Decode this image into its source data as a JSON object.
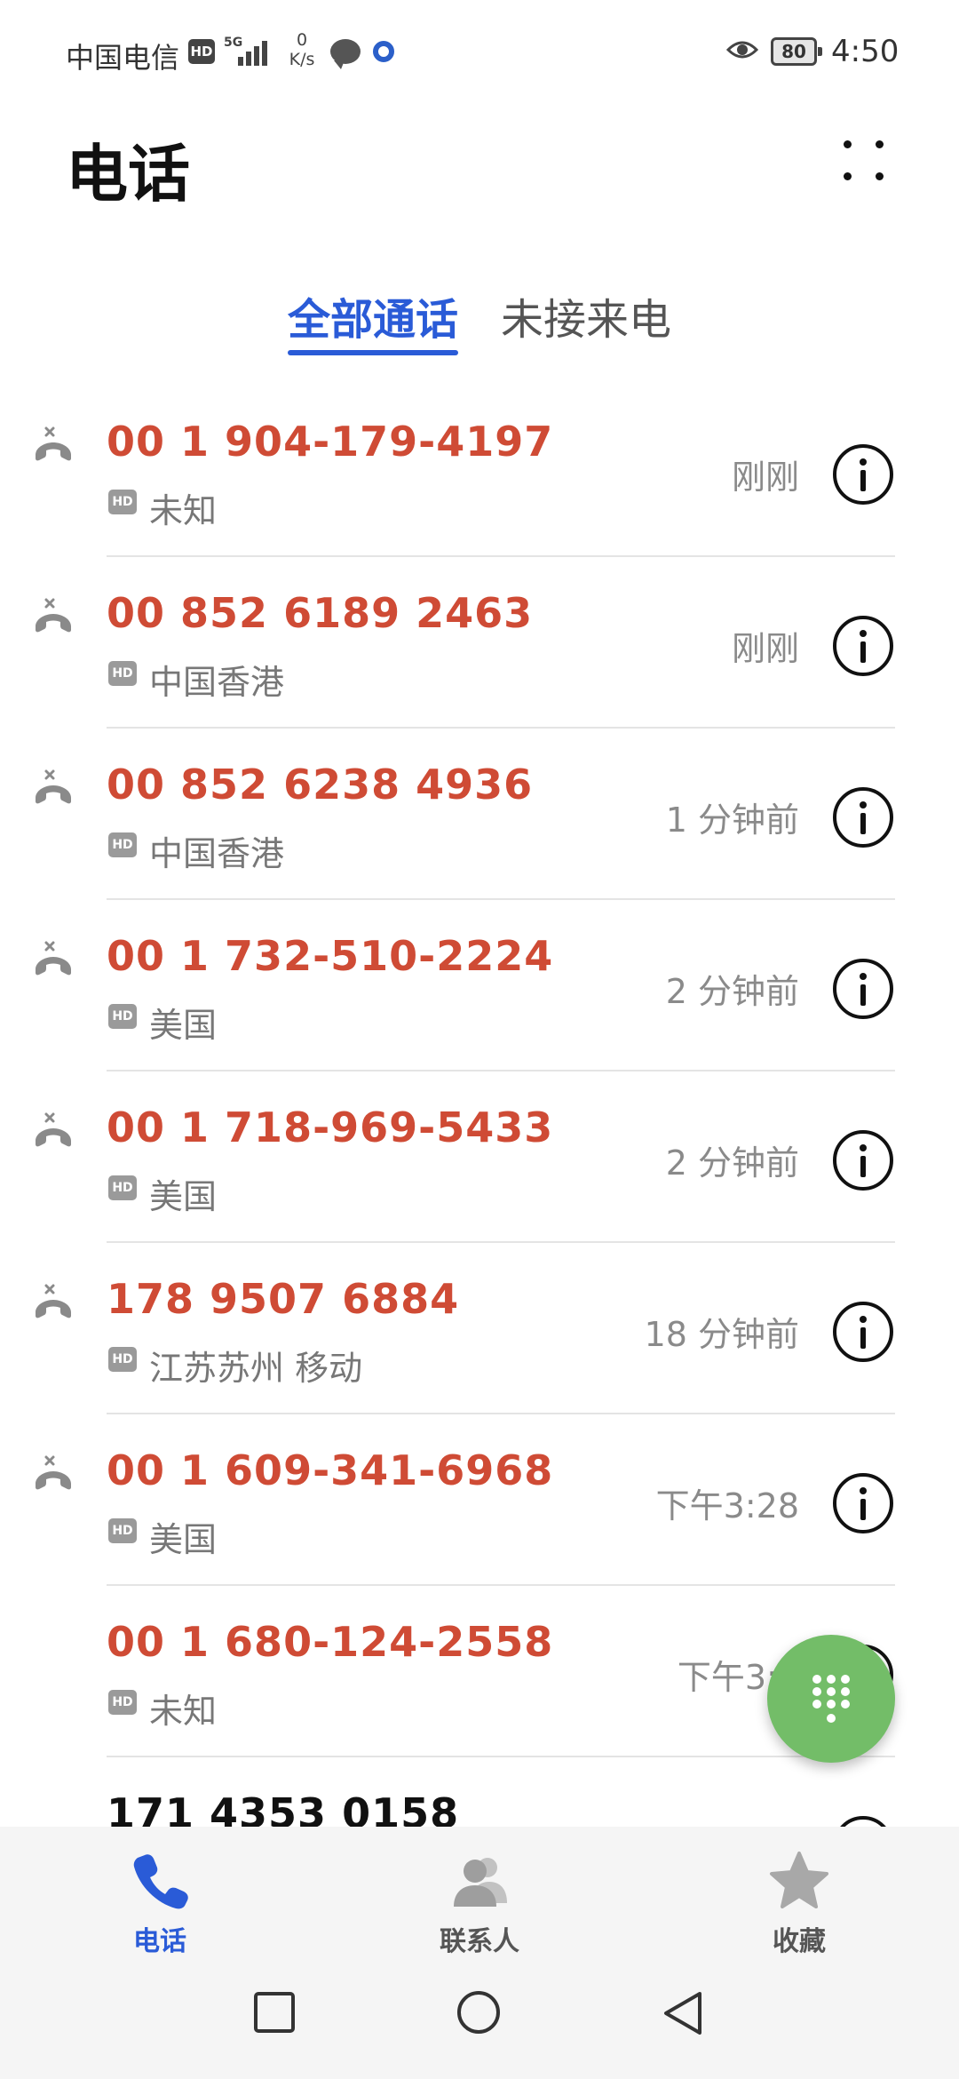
{
  "status_bar": {
    "carrier": "中国电信",
    "hd": "HD",
    "network": "5G",
    "speed_value": "0",
    "speed_unit": "K/s",
    "battery": "80",
    "time": "4:50"
  },
  "header": {
    "title": "电话"
  },
  "tabs": [
    {
      "label": "全部通话",
      "active": true
    },
    {
      "label": "未接来电",
      "active": false
    }
  ],
  "calls": [
    {
      "number": "00 1 904-179-4197",
      "location": "未知",
      "time": "刚刚",
      "missed": true
    },
    {
      "number": "00 852 6189 2463",
      "location": "中国香港",
      "time": "刚刚",
      "missed": true
    },
    {
      "number": "00 852 6238 4936",
      "location": "中国香港",
      "time": "1 分钟前",
      "missed": true
    },
    {
      "number": "00 1 732-510-2224",
      "location": "美国",
      "time": "2 分钟前",
      "missed": true
    },
    {
      "number": "00 1 718-969-5433",
      "location": "美国",
      "time": "2 分钟前",
      "missed": true
    },
    {
      "number": "178 9507 6884",
      "location": "江苏苏州 移动",
      "time": "18 分钟前",
      "missed": true
    },
    {
      "number": "00 1 609-341-6968",
      "location": "美国",
      "time": "下午3:28",
      "missed": true
    },
    {
      "number": "00 1 680-124-2558",
      "location": "未知",
      "time": "下午3:2",
      "missed": false
    },
    {
      "number": "171 4353 0158",
      "location": "",
      "time": "",
      "missed": false
    }
  ],
  "bottom_nav": [
    {
      "label": "电话",
      "icon": "phone-icon",
      "active": true
    },
    {
      "label": "联系人",
      "icon": "contacts-icon",
      "active": false
    },
    {
      "label": "收藏",
      "icon": "star-icon",
      "active": false
    }
  ],
  "colors": {
    "accent": "#2a5bd7",
    "missed": "#cf4b35",
    "fab": "#73bd68"
  }
}
